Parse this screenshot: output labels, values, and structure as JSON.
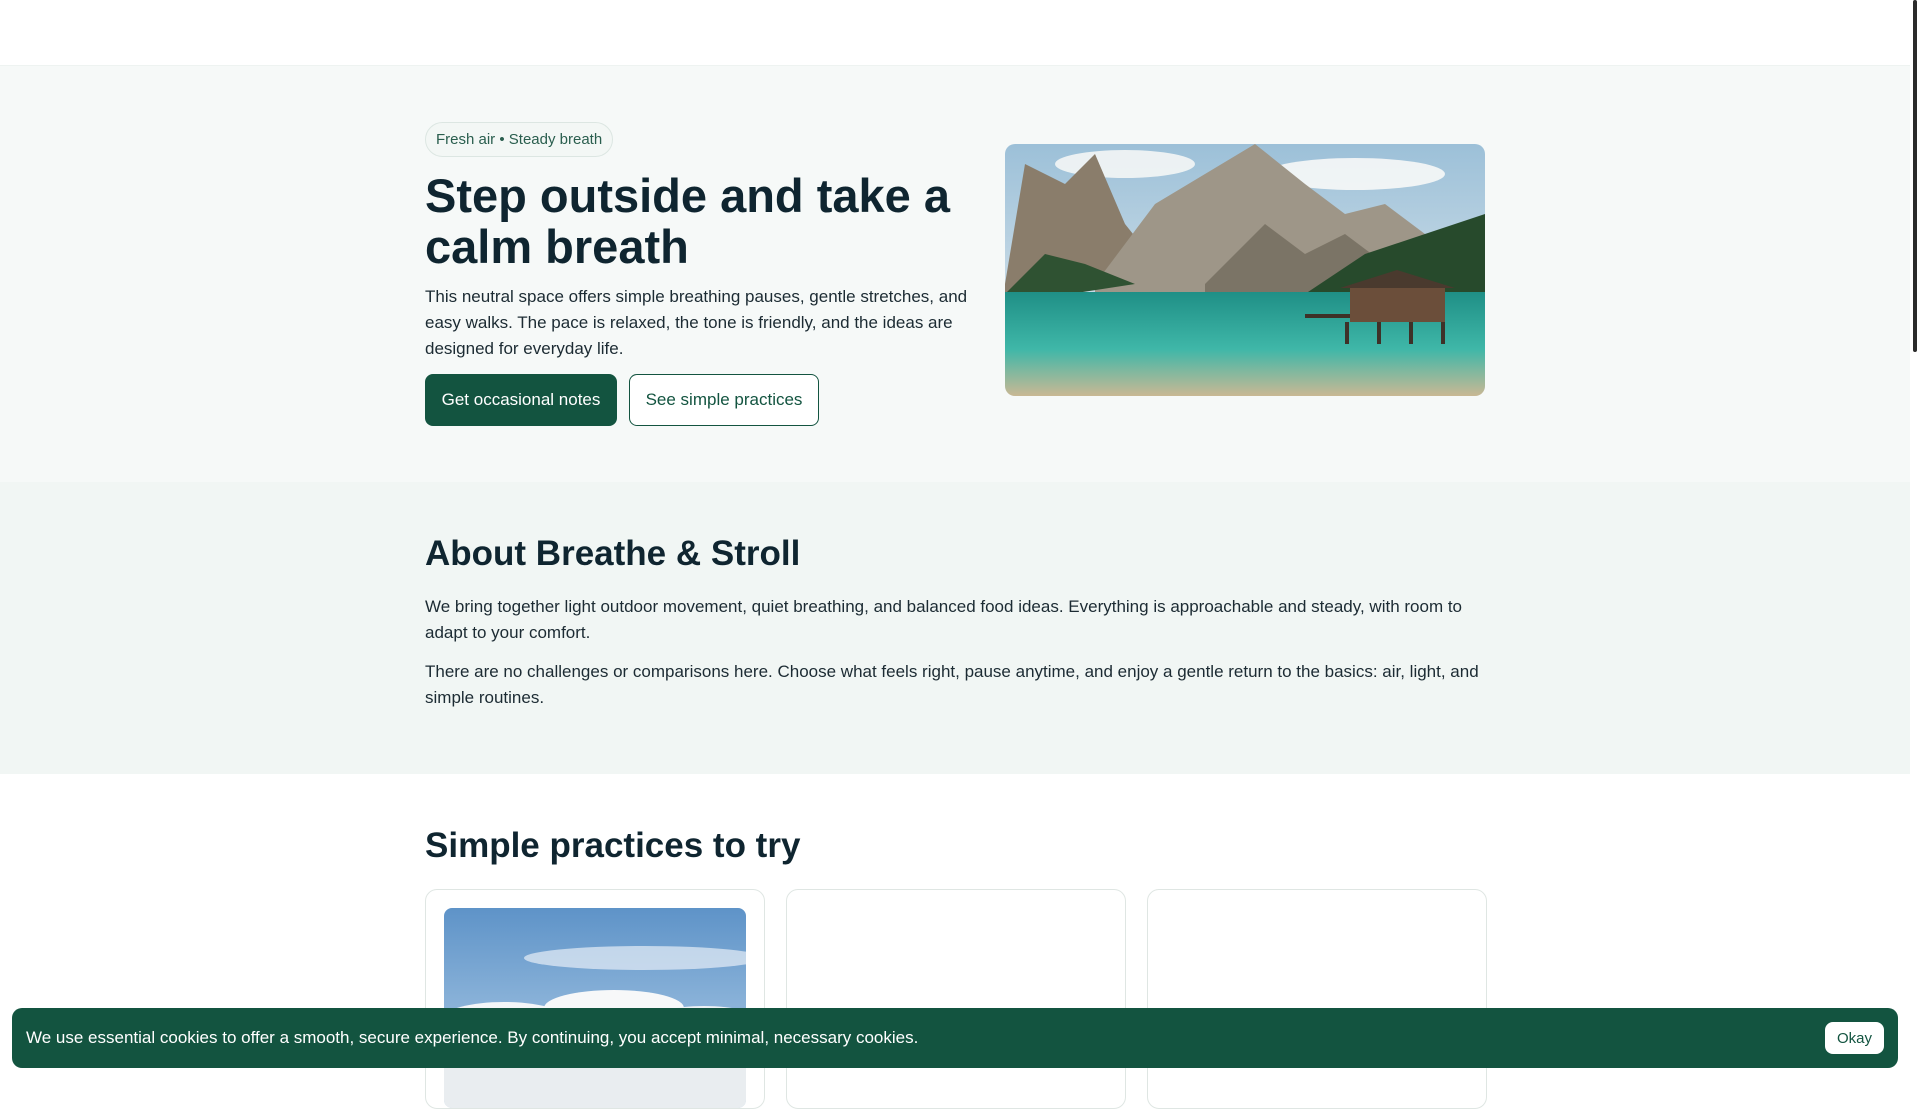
{
  "hero": {
    "pill": "Fresh air • Steady breath",
    "title": "Step outside and take a calm breath",
    "text": "This neutral space offers simple breathing pauses, gentle stretches, and easy walks. The pace is relaxed, the tone is friendly, and the ideas are designed for everyday life.",
    "primary_button": "Get occasional notes",
    "secondary_button": "See simple practices"
  },
  "about": {
    "title": "About Breathe & Stroll",
    "p1": "We bring together light outdoor movement, quiet breathing, and balanced food ideas. Everything is approachable and steady, with room to adapt to your comfort.",
    "p2": "There are no challenges or comparisons here. Choose what feels right, pause anytime, and enjoy a gentle return to the basics: air, light, and simple routines."
  },
  "practices": {
    "title": "Simple practices to try"
  },
  "cookie": {
    "text": "We use essential cookies to offer a smooth, secure experience. By continuing, you accept minimal, necessary cookies.",
    "button": "Okay"
  },
  "colors": {
    "accent": "#135440",
    "hero_bg": "#f6f9f8",
    "about_bg": "#f1f6f4"
  }
}
